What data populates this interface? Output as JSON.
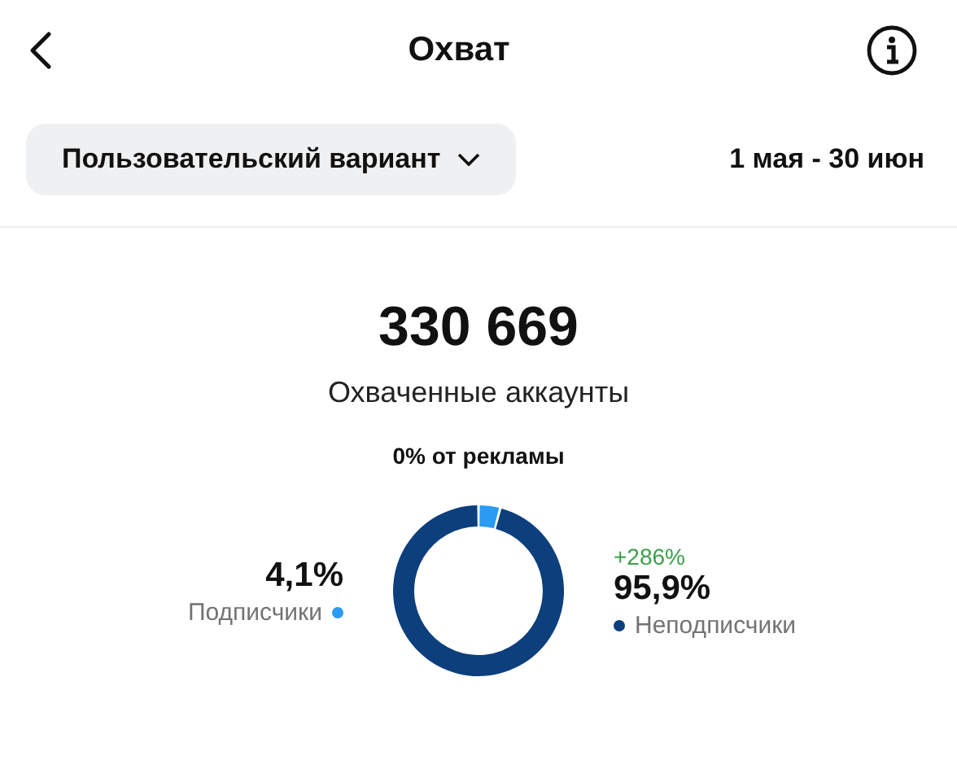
{
  "header": {
    "title": "Охват"
  },
  "filter": {
    "dropdown": "Пользовательский вариант",
    "date_range": "1 мая - 30 июн"
  },
  "summary": {
    "total": "330 669",
    "caption": "Охваченные аккаунты",
    "ads": "0% от рекламы"
  },
  "breakdown": [
    {
      "kind": "left",
      "percent": "4,1%",
      "color": "#2b9af3"
    },
    {
      "kind": "right",
      "change": "+286%",
      "percent": "95,9%",
      "color": "#0c3f7c"
    }
  ],
  "chart_data": {
    "type": "donut",
    "categories": [
      "Подписчики",
      "Неподписчики"
    ],
    "values": [
      4.1,
      95.9
    ]
  }
}
